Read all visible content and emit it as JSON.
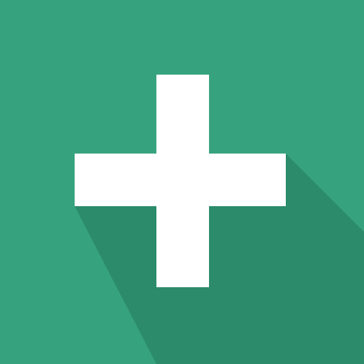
{
  "icon": {
    "name": "plus-icon"
  },
  "colors": {
    "background": "#37a37e",
    "shadow": "#2b8b6a",
    "glyph": "#ffffff"
  }
}
